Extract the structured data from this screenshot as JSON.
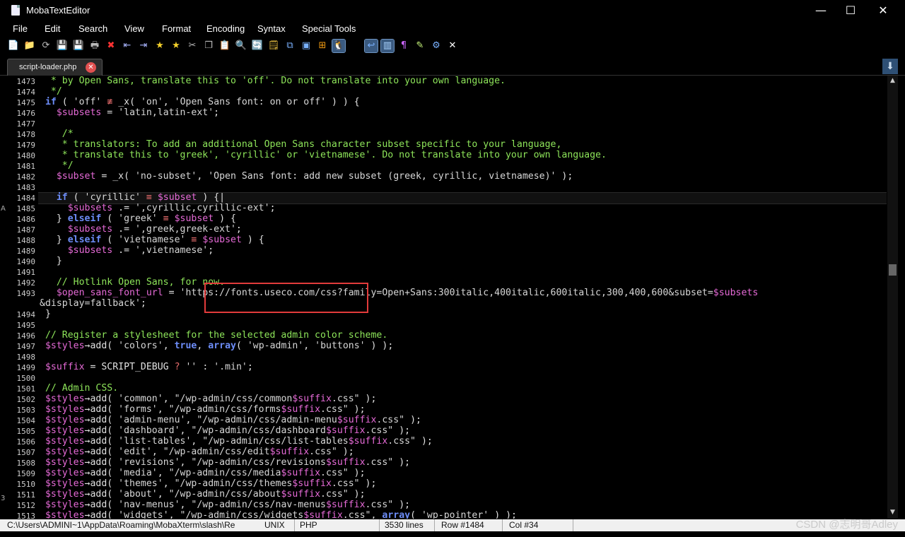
{
  "window": {
    "title": "MobaTextEditor",
    "minimize": "—",
    "maximize": "☐",
    "close": "✕"
  },
  "menu": [
    "File",
    "Edit",
    "Search",
    "View",
    "Format",
    "Encoding",
    "Syntax",
    "Special Tools"
  ],
  "toolbar_icons": [
    {
      "name": "new-file-icon",
      "glyph": "📄",
      "color": "#7ab2ff"
    },
    {
      "name": "open-folder-icon",
      "glyph": "📁",
      "color": "#f3c844"
    },
    {
      "name": "reload-icon",
      "glyph": "⟳",
      "color": "#bbbbbb"
    },
    {
      "name": "save-icon",
      "glyph": "💾",
      "color": "#999999"
    },
    {
      "name": "save-all-icon",
      "glyph": "💾",
      "color": "#888888"
    },
    {
      "name": "print-icon",
      "glyph": "🖶",
      "color": "#bbbbbb"
    },
    {
      "name": "close-file-icon",
      "glyph": "✖",
      "color": "#ff3333"
    },
    {
      "name": "indent-icon",
      "glyph": "⇤",
      "color": "#aab6ff"
    },
    {
      "name": "unindent-icon",
      "glyph": "⇥",
      "color": "#aab6ff"
    },
    {
      "name": "bookmark-icon",
      "glyph": "★",
      "color": "#f5d12b"
    },
    {
      "name": "bookmark-next-icon",
      "glyph": "★",
      "color": "#f5d12b"
    },
    {
      "name": "cut-icon",
      "glyph": "✂",
      "color": "#bbbbbb"
    },
    {
      "name": "copy-icon",
      "glyph": "❐",
      "color": "#bbbbbb"
    },
    {
      "name": "paste-icon",
      "glyph": "📋",
      "color": "#bbbbbb"
    },
    {
      "name": "find-icon",
      "glyph": "🔍",
      "color": "#7ab2ff"
    },
    {
      "name": "find-replace-icon",
      "glyph": "🔄",
      "color": "#7ab2ff"
    },
    {
      "name": "notes-icon",
      "glyph": "🗒",
      "color": "#f3c844"
    },
    {
      "name": "compare-icon",
      "glyph": "⧉",
      "color": "#7ab2ff"
    },
    {
      "name": "window-icon",
      "glyph": "▣",
      "color": "#7ab2ff"
    },
    {
      "name": "windows-line-ending-icon",
      "glyph": "⊞",
      "color": "#f39c12"
    },
    {
      "name": "linux-line-ending-icon",
      "glyph": "🐧",
      "color": "#f3c844",
      "active": true
    },
    {
      "name": "mac-line-ending-icon",
      "glyph": "",
      "color": "#7ab2ff"
    },
    {
      "name": "word-wrap-icon",
      "glyph": "↩",
      "color": "#7ab2ff",
      "active": true
    },
    {
      "name": "split-view-icon",
      "glyph": "▥",
      "color": "#aad4ff",
      "active": true
    },
    {
      "name": "show-symbols-icon",
      "glyph": "¶",
      "color": "#cc66ff"
    },
    {
      "name": "highlight-icon",
      "glyph": "✎",
      "color": "#c7f57a"
    },
    {
      "name": "settings-icon",
      "glyph": "⚙",
      "color": "#7ab2ff"
    },
    {
      "name": "close-editor-icon",
      "glyph": "✕",
      "color": "#ffffff"
    }
  ],
  "tab": {
    "label": "script-loader.php",
    "close": "✕",
    "arrow": "⬇"
  },
  "editor": {
    "lines": [
      {
        "n": "1473",
        "html": "  <span class='c-c'>* by Open Sans, translate this to 'off'. Do not translate into your own language.</span>"
      },
      {
        "n": "1474",
        "html": "  <span class='c-c'>*/</span>"
      },
      {
        "n": "1475",
        "html": " <span class='c-k'>if</span> ( <span class='c-s'>'off'</span> <span class='c-o'>≢</span> _x( <span class='c-s'>'on'</span>, <span class='c-s'>'Open Sans font: on or off'</span> ) ) {"
      },
      {
        "n": "1476",
        "html": "   <span class='c-v'>$subsets</span> = <span class='c-s'>'latin,latin-ext'</span>;"
      },
      {
        "n": "1477",
        "html": ""
      },
      {
        "n": "1478",
        "html": "    <span class='c-c'>/*</span>"
      },
      {
        "n": "1479",
        "html": "    <span class='c-c'>* translators: To add an additional Open Sans character subset specific to your language,</span>"
      },
      {
        "n": "1480",
        "html": "    <span class='c-c'>* translate this to 'greek', 'cyrillic' or 'vietnamese'. Do not translate into your own language.</span>"
      },
      {
        "n": "1481",
        "html": "    <span class='c-c'>*/</span>"
      },
      {
        "n": "1482",
        "html": "   <span class='c-v'>$subset</span> = _x( <span class='c-s'>'no-subset'</span>, <span class='c-s'>'Open Sans font: add new subset (greek, cyrillic, vietnamese)'</span> );"
      },
      {
        "n": "1483",
        "html": ""
      },
      {
        "n": "1484",
        "html": "   <span class='c-k'>if</span> ( <span class='c-s'>'cyrillic'</span> <span class='c-o'>≡</span> <span class='c-v'>$subset</span> ) {|"
      },
      {
        "n": "1485",
        "html": "     <span class='c-v'>$subsets</span> .= <span class='c-s'>',cyrillic,cyrillic-ext'</span>;"
      },
      {
        "n": "1486",
        "html": "   } <span class='c-k'>elseif</span> ( <span class='c-s'>'greek'</span> <span class='c-o'>≡</span> <span class='c-v'>$subset</span> ) {"
      },
      {
        "n": "1487",
        "html": "     <span class='c-v'>$subsets</span> .= <span class='c-s'>',greek,greek-ext'</span>;"
      },
      {
        "n": "1488",
        "html": "   } <span class='c-k'>elseif</span> ( <span class='c-s'>'vietnamese'</span> <span class='c-o'>≡</span> <span class='c-v'>$subset</span> ) {"
      },
      {
        "n": "1489",
        "html": "     <span class='c-v'>$subsets</span> .= <span class='c-s'>',vietnamese'</span>;"
      },
      {
        "n": "1490",
        "html": "   }"
      },
      {
        "n": "1491",
        "html": ""
      },
      {
        "n": "1492",
        "html": "   <span class='c-c'>// Hotlink Open Sans, for now.</span>"
      },
      {
        "n": "1493",
        "html": "   <span class='c-v'>$open_sans_font_url</span> = <span class='c-s'>'https://fonts.useco.com/css?family=Open+Sans:300italic,400italic,600italic,300,400,600&amp;subset=</span><span class='c-v'>$subsets</span>"
      },
      {
        "n": "",
        "html": "<span class='c-s'>&amp;display=fallback'</span>;"
      },
      {
        "n": "1494",
        "html": " }"
      },
      {
        "n": "1495",
        "html": ""
      },
      {
        "n": "1496",
        "html": " <span class='c-c'>// Register a stylesheet for the selected admin color scheme.</span>"
      },
      {
        "n": "1497",
        "html": " <span class='c-v'>$styles</span>→add( <span class='c-s'>'colors'</span>, <span class='c-k'>true</span>, <span class='c-k'>array</span>( <span class='c-s'>'wp-admin'</span>, <span class='c-s'>'buttons'</span> ) );"
      },
      {
        "n": "1498",
        "html": ""
      },
      {
        "n": "1499",
        "html": " <span class='c-v'>$suffix</span> = SCRIPT_DEBUG <span class='c-o'>?</span> <span class='c-s'>''</span> : <span class='c-s'>'.min'</span>;"
      },
      {
        "n": "1500",
        "html": ""
      },
      {
        "n": "1501",
        "html": " <span class='c-c'>// Admin CSS.</span>"
      },
      {
        "n": "1502",
        "html": " <span class='c-v'>$styles</span>→add( <span class='c-s'>'common'</span>, <span class='c-s'>\"/wp-admin/css/common</span><span class='c-v'>$suffix</span><span class='c-s'>.css\"</span> );"
      },
      {
        "n": "1503",
        "html": " <span class='c-v'>$styles</span>→add( <span class='c-s'>'forms'</span>, <span class='c-s'>\"/wp-admin/css/forms</span><span class='c-v'>$suffix</span><span class='c-s'>.css\"</span> );"
      },
      {
        "n": "1504",
        "html": " <span class='c-v'>$styles</span>→add( <span class='c-s'>'admin-menu'</span>, <span class='c-s'>\"/wp-admin/css/admin-menu</span><span class='c-v'>$suffix</span><span class='c-s'>.css\"</span> );"
      },
      {
        "n": "1505",
        "html": " <span class='c-v'>$styles</span>→add( <span class='c-s'>'dashboard'</span>, <span class='c-s'>\"/wp-admin/css/dashboard</span><span class='c-v'>$suffix</span><span class='c-s'>.css\"</span> );"
      },
      {
        "n": "1506",
        "html": " <span class='c-v'>$styles</span>→add( <span class='c-s'>'list-tables'</span>, <span class='c-s'>\"/wp-admin/css/list-tables</span><span class='c-v'>$suffix</span><span class='c-s'>.css\"</span> );"
      },
      {
        "n": "1507",
        "html": " <span class='c-v'>$styles</span>→add( <span class='c-s'>'edit'</span>, <span class='c-s'>\"/wp-admin/css/edit</span><span class='c-v'>$suffix</span><span class='c-s'>.css\"</span> );"
      },
      {
        "n": "1508",
        "html": " <span class='c-v'>$styles</span>→add( <span class='c-s'>'revisions'</span>, <span class='c-s'>\"/wp-admin/css/revisions</span><span class='c-v'>$suffix</span><span class='c-s'>.css\"</span> );"
      },
      {
        "n": "1509",
        "html": " <span class='c-v'>$styles</span>→add( <span class='c-s'>'media'</span>, <span class='c-s'>\"/wp-admin/css/media</span><span class='c-v'>$suffix</span><span class='c-s'>.css\"</span> );"
      },
      {
        "n": "1510",
        "html": " <span class='c-v'>$styles</span>→add( <span class='c-s'>'themes'</span>, <span class='c-s'>\"/wp-admin/css/themes</span><span class='c-v'>$suffix</span><span class='c-s'>.css\"</span> );"
      },
      {
        "n": "1511",
        "html": " <span class='c-v'>$styles</span>→add( <span class='c-s'>'about'</span>, <span class='c-s'>\"/wp-admin/css/about</span><span class='c-v'>$suffix</span><span class='c-s'>.css\"</span> );"
      },
      {
        "n": "1512",
        "html": " <span class='c-v'>$styles</span>→add( <span class='c-s'>'nav-menus'</span>, <span class='c-s'>\"/wp-admin/css/nav-menus</span><span class='c-v'>$suffix</span><span class='c-s'>.css\"</span> );"
      },
      {
        "n": "1513",
        "html": " <span class='c-v'>$styles</span>→add( <span class='c-s'>'widgets'</span>, <span class='c-s'>\"/wp-admin/css/widgets</span><span class='c-v'>$suffix</span><span class='c-s'>.css\"</span>, <span class='c-k'>array</span>( <span class='c-s'>'wp-pointer'</span> ) );"
      }
    ]
  },
  "status": {
    "path": "C:\\Users\\ADMINI~1\\AppData\\Roaming\\MobaXterm\\slash\\Re",
    "eol": "UNIX",
    "syntax": "PHP",
    "lines": "3530 lines",
    "row": "Row #1484",
    "col": "Col #34"
  },
  "watermark": "CSDN @志明哥Adley"
}
